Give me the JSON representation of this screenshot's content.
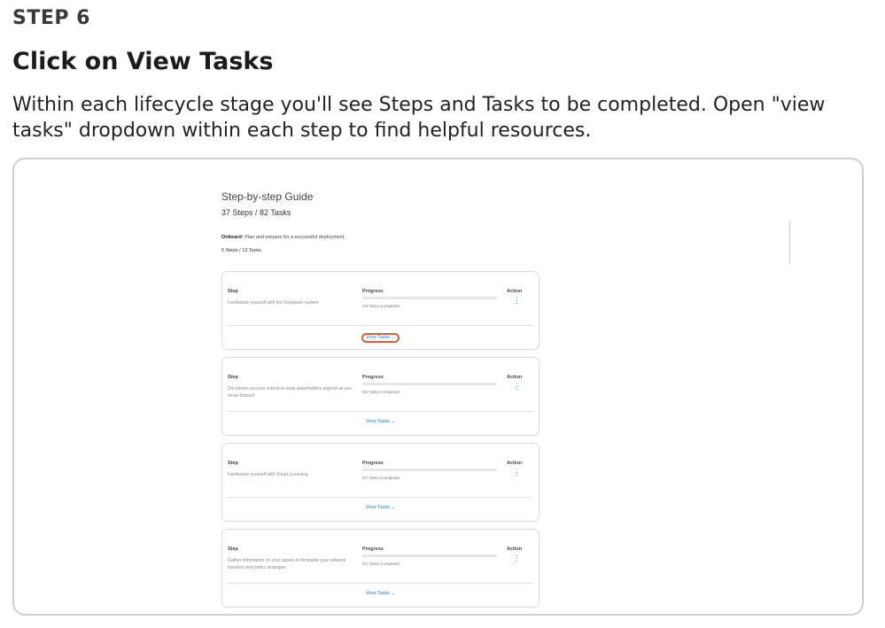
{
  "step_label": "STEP 6",
  "heading": "Click on View Tasks",
  "description": "Within each lifecycle stage you'll see Steps and Tasks to be completed. Open \"view tasks\" dropdown within each step to find helpful resources.",
  "screenshot": {
    "guide_title": "Step-by-step Guide",
    "guide_count": "37 Steps / 82 Tasks",
    "onboard_label": "Onboard:",
    "onboard_text": "Plan and prepare for a successful deployment.",
    "onboard_count": "5 Steps / 13 Tasks",
    "col_step": "Step",
    "col_progress": "Progress",
    "col_action": "Action",
    "view_tasks_label": "View Tasks",
    "highlight_color": "#e65a2e",
    "accent_color": "#1e88e5",
    "cards": [
      {
        "step": "Familiarize yourself with the Firepower system",
        "progress_text": "0/3 Tasks Completed",
        "progress": 0
      },
      {
        "step": "Document success criteria to keep stakeholders aligned as you move forward",
        "progress_text": "0/2 Tasks Completed",
        "progress": 0
      },
      {
        "step": "Familiarize yourself with Smart Licensing",
        "progress_text": "0/1 Tasks Completed",
        "progress": 0
      },
      {
        "step": "Gather information on your assets to formulate your network insertion and policy strategies",
        "progress_text": "0/1 Tasks Completed",
        "progress": 0
      }
    ]
  }
}
